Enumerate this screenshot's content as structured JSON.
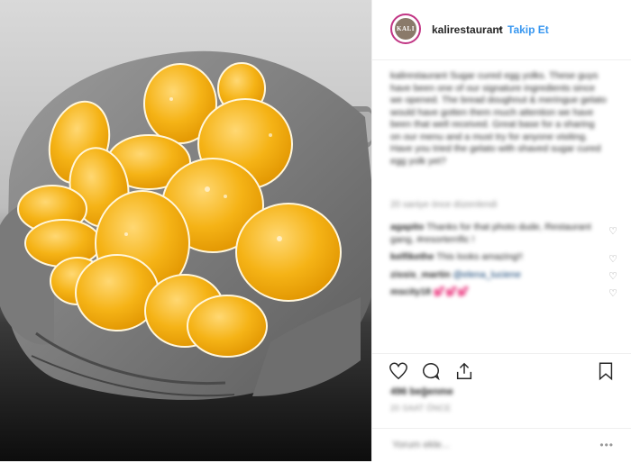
{
  "header": {
    "avatar_text": "KALI",
    "username": "kalirestaurant",
    "separator": "•",
    "follow_label": "Takip Et"
  },
  "caption": {
    "text": "kalirestaurant Sugar cured egg yolks. These guys have been one of our signature ingredients since we opened. The bread doughnut & meringue gelato would have gotten them much attention we have been that well received. Great base for a sharing on our menu and a must try for anyone visiting. Have you tried the gelato with shaved sugar cured egg yolk yet?"
  },
  "time_ago_1": "20 saniye önce düzenlendi",
  "comments": [
    {
      "user": "agapito",
      "text": "Thanks for that photo dude, Restaurant gang, #resorterrific !"
    },
    {
      "user": "kelfikethe",
      "text": "This looks amazing!!"
    },
    {
      "user": "zissis_martin",
      "text": "@elena_luciene"
    },
    {
      "user": "mscity18",
      "text": "💕💕💕"
    }
  ],
  "likes": "496 beğenme",
  "time_ago_2": "20 SAAT ÖNCE",
  "add_comment_placeholder": "Yorum ekle...",
  "more_label": "•••",
  "icons": [
    "heart-icon",
    "comment-icon",
    "share-icon",
    "bookmark-icon"
  ],
  "colors": {
    "link": "#3897f0",
    "avatar_ring": "#c13584"
  }
}
